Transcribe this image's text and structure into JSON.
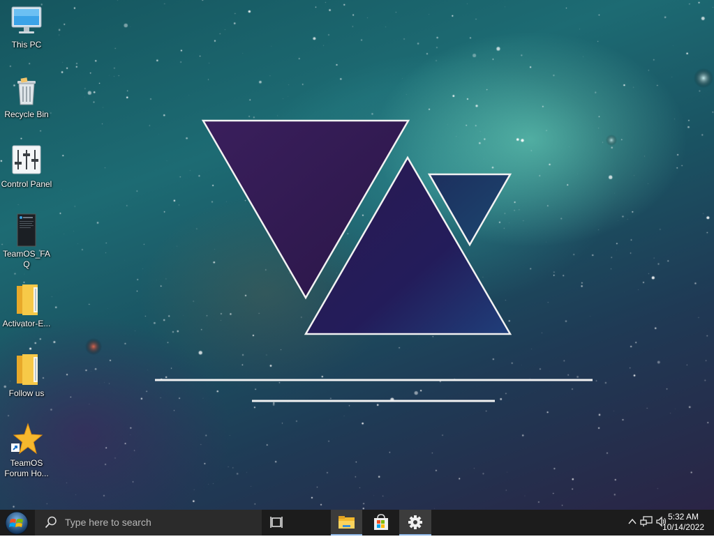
{
  "desktop": {
    "icons": [
      {
        "label": "This PC",
        "icon": "computer-icon"
      },
      {
        "label": "Recycle Bin",
        "icon": "recycle-bin-icon"
      },
      {
        "label": "Control Panel",
        "icon": "control-panel-icon"
      },
      {
        "label": "TeamOS_FAQ",
        "icon": "document-icon"
      },
      {
        "label": "Activator-E...",
        "icon": "folder-icon"
      },
      {
        "label": "Follow us",
        "icon": "folder-icon"
      },
      {
        "label": "TeamOS Forum Ho...",
        "icon": "star-shortcut-icon"
      }
    ]
  },
  "taskbar": {
    "start_icon": "windows-start-orb-icon",
    "search_placeholder": "Type here to search",
    "search_icon": "search-icon",
    "task_view_icon": "task-view-icon",
    "pinned": [
      {
        "name": "File Explorer",
        "icon": "file-explorer-icon",
        "active": true
      },
      {
        "name": "Microsoft Store",
        "icon": "store-icon",
        "active": false
      },
      {
        "name": "Settings",
        "icon": "gear-icon",
        "active": true
      }
    ],
    "tray": {
      "icons": [
        "chevron-up-icon",
        "network-icon",
        "volume-icon"
      ],
      "time": "5:32 AM",
      "date": "10/14/2022"
    }
  },
  "colors": {
    "taskbar_bg": "#1c1c1c",
    "search_bg": "#2b2b2b",
    "active_underline": "#8fb8e8"
  }
}
